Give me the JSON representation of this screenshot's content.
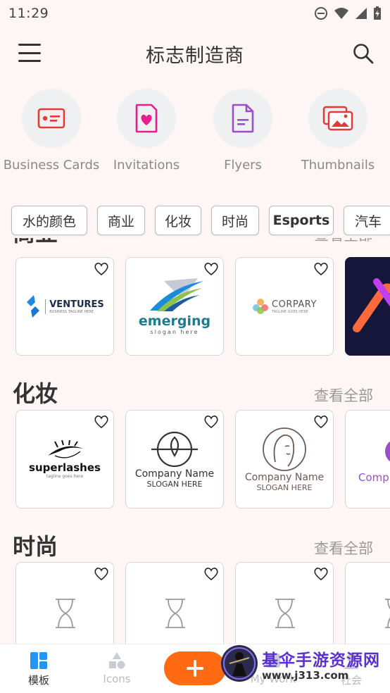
{
  "status_bar": {
    "time": "11:29"
  },
  "app_bar": {
    "title": "标志制造商"
  },
  "categories": [
    {
      "label": "Business Cards",
      "icon": "business-card-icon"
    },
    {
      "label": "Invitations",
      "icon": "invitation-heart-icon"
    },
    {
      "label": "Flyers",
      "icon": "flyer-document-icon"
    },
    {
      "label": "Thumbnails",
      "icon": "thumbnail-image-icon"
    }
  ],
  "chips": [
    "水的颜色",
    "商业",
    "化妆",
    "时尚",
    "Esports",
    "汽车"
  ],
  "sections": [
    {
      "name": "商业",
      "more": "查看全部",
      "cards": [
        {
          "text": "VENTURES",
          "sub": "BUSINESS TAGLINE HERE"
        },
        {
          "text": "emerging",
          "sub": "slogan here"
        },
        {
          "text": "CORPARY",
          "sub": "TAGLINE GOES HERE"
        },
        {
          "text": "",
          "sub": ""
        }
      ]
    },
    {
      "name": "化妆",
      "more": "查看全部",
      "cards": [
        {
          "text": "superlashes",
          "sub": "tagline goes here"
        },
        {
          "text": "Company Name",
          "sub": "SLOGAN HERE"
        },
        {
          "text": "Company Name",
          "sub": "SLOGAN HERE"
        },
        {
          "text": "Comp",
          "sub": ""
        }
      ]
    },
    {
      "name": "时尚",
      "more": "查看全部",
      "cards": [
        {
          "text": "",
          "sub": ""
        },
        {
          "text": "",
          "sub": ""
        },
        {
          "text": "",
          "sub": ""
        },
        {
          "text": "",
          "sub": ""
        }
      ]
    }
  ],
  "bottom_nav": [
    {
      "label": "模板",
      "icon": "templates-grid-icon",
      "active": true
    },
    {
      "label": "Icons",
      "icon": "shapes-icon",
      "active": false
    },
    {
      "label": "My Work",
      "icon": "my-work-icon",
      "active": false
    },
    {
      "label": "社会",
      "icon": "social-icon",
      "active": false
    }
  ],
  "fab": {
    "icon": "plus-icon"
  },
  "watermark": {
    "title": "基伞手游资源网",
    "url": "www.j313.com"
  },
  "colors": {
    "accent": "#ff6a13",
    "pink": "#e91e8c",
    "red": "#e53935",
    "purple": "#9c4dcc",
    "background": "#fdf6f5"
  }
}
